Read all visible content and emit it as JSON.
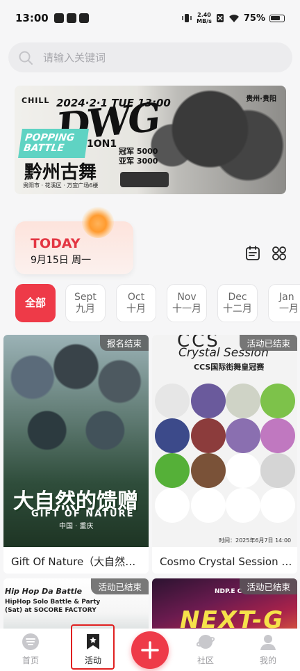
{
  "status_bar": {
    "time": "13:00",
    "speed_value": "2.40",
    "speed_unit": "MB/s",
    "battery": "75%"
  },
  "search": {
    "placeholder": "请输入关键词"
  },
  "banner": {
    "logo": "CHILL",
    "date": "2024·2·1 TUE 13:00",
    "big_text": "DWG",
    "popping": [
      "POPPING",
      "BATTLE"
    ],
    "format": "1ON1",
    "title": "黔州古舞",
    "prizes": [
      "冠军 5000",
      "亚军 3000"
    ],
    "address": "贵阳市 · 花溪区 · 万宜广场6楼",
    "city": "贵州·贵阳"
  },
  "today": {
    "title": "TODAY",
    "date": "9月15日 周一"
  },
  "month_chips": [
    {
      "label": "全部"
    },
    {
      "en": "Sept",
      "cn": "九月"
    },
    {
      "en": "Oct",
      "cn": "十月"
    },
    {
      "en": "Nov",
      "cn": "十一月"
    },
    {
      "en": "Dec",
      "cn": "十二月"
    },
    {
      "en": "Jan",
      "cn": "一月"
    }
  ],
  "events": [
    {
      "badge": "报名结束",
      "name": "Gift Of Nature（大自然的馈赠）",
      "poster_title": "大自然的馈赠",
      "poster_sub": "GIFT OF NATURE",
      "poster_city": "中国 · 重庆"
    },
    {
      "badge": "活动已结束",
      "name": "Cosmo Crystal Session 国际街舞皇冠赛",
      "poster_logo": "CCS",
      "poster_sub": "Crystal Session",
      "poster_cn": "CCS国际街舞皇冠赛",
      "poster_time": "时间：2025年6月7日 14:00"
    },
    {
      "badge": "活动已结束",
      "poster_line1": "Hip Hop Da Battle",
      "poster_line2": "HipHop Solo Battle & Party",
      "poster_line3": "(Sat) at SOCORE FACTORY"
    },
    {
      "badge": "活动已结束",
      "poster_big": "NEXT-G",
      "poster_small": "NDP.E C"
    }
  ],
  "nav": {
    "home": "首页",
    "activity": "活动",
    "community": "社区",
    "mine": "我的"
  },
  "colors": {
    "accent": "#ee3a48",
    "badge_bg": "#5a5a5a",
    "today_red": "#e33643"
  }
}
